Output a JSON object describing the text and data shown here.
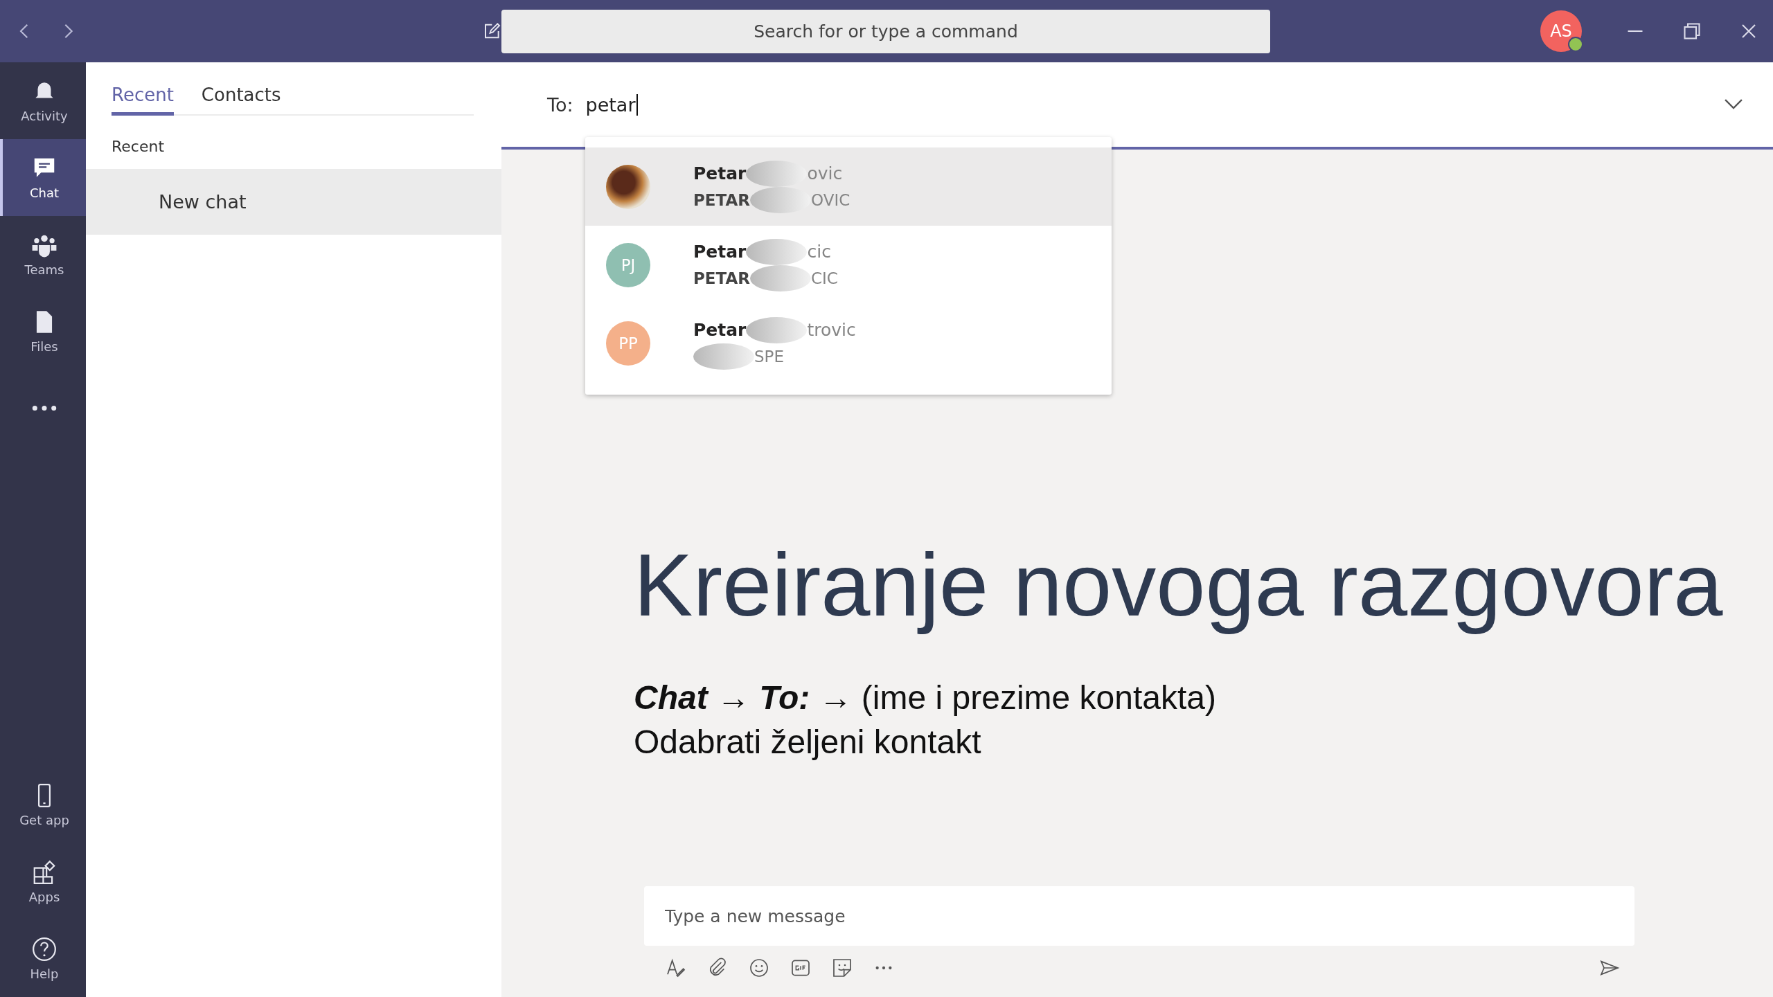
{
  "title_bar": {
    "search": {
      "placeholder": "Search for or type a command"
    },
    "avatar": {
      "initials": "AS"
    }
  },
  "rail": {
    "top": [
      {
        "kind": "bell",
        "label": "Activity",
        "selected": false
      },
      {
        "kind": "chat",
        "label": "Chat",
        "selected": true
      },
      {
        "kind": "teams",
        "label": "Teams",
        "selected": false
      },
      {
        "kind": "file",
        "label": "Files",
        "selected": false
      },
      {
        "kind": "more",
        "selected": false
      }
    ],
    "bottom": [
      {
        "kind": "phone",
        "label": "Get app",
        "selected": false
      },
      {
        "kind": "apps",
        "label": "Apps",
        "selected": false
      },
      {
        "kind": "help",
        "label": "Help",
        "selected": false
      }
    ]
  },
  "side_panel": {
    "tabs": [
      {
        "label": "Recent",
        "selected": true
      },
      {
        "label": "Contacts",
        "selected": false
      }
    ],
    "section": "Recent",
    "items": [
      {
        "label": "New chat",
        "selected": true
      }
    ]
  },
  "compose_header": {
    "to_label": "To:",
    "to_value": "petar"
  },
  "suggestions": [
    {
      "kind": "photo",
      "name": "Petar",
      "name_tail": "ovic",
      "subtitle": "PETAR",
      "subtitle_tail": "OVIC",
      "selected": true
    },
    {
      "kind": "initials",
      "initials": "PJ",
      "color": "#8fbfb1",
      "name": "Petar",
      "name_tail": "cic",
      "subtitle": "PETAR",
      "subtitle_tail": "CIC",
      "selected": false
    },
    {
      "kind": "initials",
      "initials": "PP",
      "color": "#f4b08a",
      "name": "Petar",
      "name_tail": "trovic",
      "subtitle_tail": "SPE",
      "selected": false
    }
  ],
  "slide": {
    "title": "Kreiranje novoga razgovora",
    "lines": [
      "**Chat** → **To:** → (ime i prezime kontakta)",
      "Odabrati željeni kontakt"
    ]
  },
  "composer": {
    "placeholder": "Type a new message",
    "tools": [
      {
        "kind": "format"
      },
      {
        "kind": "attach"
      },
      {
        "kind": "emoji"
      },
      {
        "kind": "gif"
      },
      {
        "kind": "sticker"
      },
      {
        "kind": "more"
      }
    ]
  }
}
